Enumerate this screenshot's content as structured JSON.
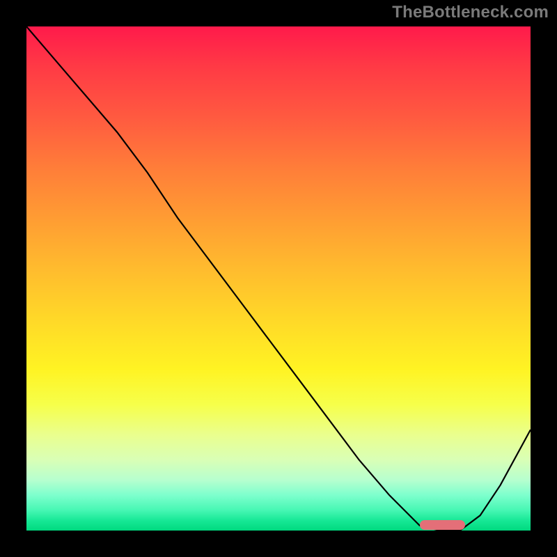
{
  "watermark": "TheBottleneck.com",
  "colors": {
    "gradient_top": "#ff1a4b",
    "gradient_mid": "#ffd828",
    "gradient_bottom": "#00d97f",
    "curve": "#000000",
    "marker": "#e46f78",
    "frame": "#000000"
  },
  "chart_data": {
    "type": "line",
    "title": "",
    "xlabel": "",
    "ylabel": "",
    "xlim": [
      0,
      100
    ],
    "ylim": [
      0,
      100
    ],
    "series": [
      {
        "name": "bottleneck-curve",
        "x": [
          0,
          6,
          12,
          18,
          24,
          30,
          36,
          42,
          48,
          54,
          60,
          66,
          72,
          78,
          82,
          86,
          90,
          94,
          100
        ],
        "values": [
          100,
          93,
          86,
          79,
          71,
          62,
          54,
          46,
          38,
          30,
          22,
          14,
          7,
          1,
          0,
          0,
          3,
          9,
          20
        ]
      }
    ],
    "marker": {
      "x_start": 78,
      "x_end": 87,
      "y": 1
    }
  }
}
